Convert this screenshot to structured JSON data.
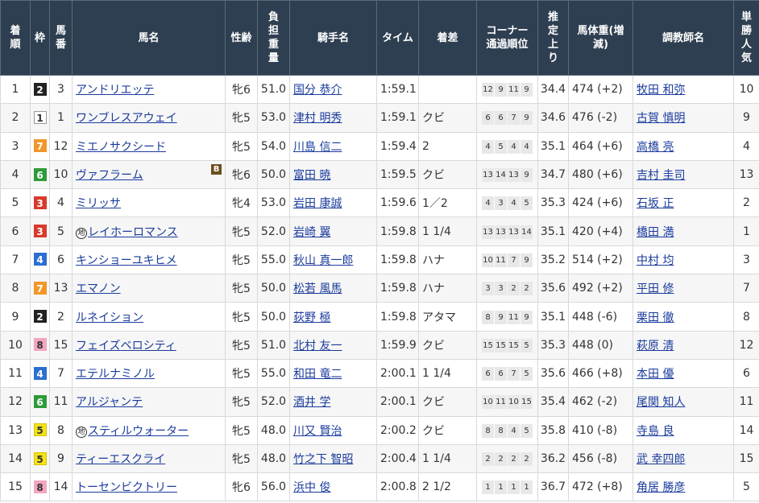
{
  "headers": {
    "rank": "着順",
    "frame": "枠",
    "num": "馬番",
    "horse": "馬名",
    "sexage": "性齢",
    "weight": "負担重量",
    "jockey": "騎手名",
    "time": "タイム",
    "margin": "着差",
    "corner": "コーナー通過順位",
    "last3f": "推定上り",
    "body": "馬体重(増減)",
    "trainer": "調教師名",
    "pop": "単勝人気"
  },
  "frame_colors": {
    "1": {
      "bg": "#ffffff",
      "fg": "#333333",
      "border": "#999999"
    },
    "2": {
      "bg": "#222222",
      "fg": "#ffffff",
      "border": "#222222"
    },
    "3": {
      "bg": "#d93a2b",
      "fg": "#ffffff",
      "border": "#d93a2b"
    },
    "4": {
      "bg": "#2a6fd1",
      "fg": "#ffffff",
      "border": "#2a6fd1"
    },
    "5": {
      "bg": "#f4e21a",
      "fg": "#333333",
      "border": "#d8c400"
    },
    "6": {
      "bg": "#2f9a3a",
      "fg": "#ffffff",
      "border": "#2f9a3a"
    },
    "7": {
      "bg": "#f2962a",
      "fg": "#ffffff",
      "border": "#f2962a"
    },
    "8": {
      "bg": "#f4a6c0",
      "fg": "#333333",
      "border": "#f4a6c0"
    }
  },
  "rows": [
    {
      "rank": "1",
      "frame": "2",
      "num": "3",
      "horse": "アンドリエッテ",
      "chihou": false,
      "blinker": false,
      "sexage": "牝6",
      "weight": "51.0",
      "jockey": "国分 恭介",
      "time": "1:59.1",
      "margin": "",
      "corner": [
        "12",
        "9",
        "11",
        "9"
      ],
      "last3f": "34.4",
      "body": "474 (+2)",
      "trainer": "牧田 和弥",
      "pop": "10"
    },
    {
      "rank": "2",
      "frame": "1",
      "num": "1",
      "horse": "ワンブレスアウェイ",
      "chihou": false,
      "blinker": false,
      "sexage": "牝5",
      "weight": "53.0",
      "jockey": "津村 明秀",
      "time": "1:59.1",
      "margin": "クビ",
      "corner": [
        "6",
        "6",
        "7",
        "9"
      ],
      "last3f": "34.6",
      "body": "476 (-2)",
      "trainer": "古賀 慎明",
      "pop": "9"
    },
    {
      "rank": "3",
      "frame": "7",
      "num": "12",
      "horse": "ミエノサクシード",
      "chihou": false,
      "blinker": false,
      "sexage": "牝5",
      "weight": "54.0",
      "jockey": "川島 信二",
      "time": "1:59.4",
      "margin": "2",
      "corner": [
        "4",
        "5",
        "4",
        "4"
      ],
      "last3f": "35.1",
      "body": "464 (+6)",
      "trainer": "高橋 亮",
      "pop": "4"
    },
    {
      "rank": "4",
      "frame": "6",
      "num": "10",
      "horse": "ヴァフラーム",
      "chihou": false,
      "blinker": true,
      "blinker_label": "B",
      "sexage": "牝6",
      "weight": "50.0",
      "jockey": "富田 暁",
      "time": "1:59.5",
      "margin": "クビ",
      "corner": [
        "13",
        "14",
        "13",
        "9"
      ],
      "last3f": "34.7",
      "body": "480 (+6)",
      "trainer": "吉村 圭司",
      "pop": "13"
    },
    {
      "rank": "5",
      "frame": "3",
      "num": "4",
      "horse": "ミリッサ",
      "chihou": false,
      "blinker": false,
      "sexage": "牝4",
      "weight": "53.0",
      "jockey": "岩田 康誠",
      "time": "1:59.6",
      "margin": "1／2",
      "corner": [
        "4",
        "3",
        "4",
        "5"
      ],
      "last3f": "35.3",
      "body": "424 (+6)",
      "trainer": "石坂 正",
      "pop": "2"
    },
    {
      "rank": "6",
      "frame": "3",
      "num": "5",
      "horse": "レイホーロマンス",
      "chihou": true,
      "chihou_label": "地",
      "blinker": false,
      "sexage": "牝5",
      "weight": "52.0",
      "jockey": "岩崎 翼",
      "time": "1:59.8",
      "margin": "1 1/4",
      "corner": [
        "13",
        "13",
        "13",
        "14"
      ],
      "last3f": "35.1",
      "body": "420 (+4)",
      "trainer": "橋田 満",
      "pop": "1"
    },
    {
      "rank": "7",
      "frame": "4",
      "num": "6",
      "horse": "キンショーユキヒメ",
      "chihou": false,
      "blinker": false,
      "sexage": "牝5",
      "weight": "55.0",
      "jockey": "秋山 真一郎",
      "time": "1:59.8",
      "margin": "ハナ",
      "corner": [
        "10",
        "11",
        "7",
        "9"
      ],
      "last3f": "35.2",
      "body": "514 (+2)",
      "trainer": "中村 均",
      "pop": "3"
    },
    {
      "rank": "8",
      "frame": "7",
      "num": "13",
      "horse": "エマノン",
      "chihou": false,
      "blinker": false,
      "sexage": "牝5",
      "weight": "50.0",
      "jockey": "松若 風馬",
      "time": "1:59.8",
      "margin": "ハナ",
      "corner": [
        "3",
        "3",
        "2",
        "2"
      ],
      "last3f": "35.6",
      "body": "492 (+2)",
      "trainer": "平田 修",
      "pop": "7"
    },
    {
      "rank": "9",
      "frame": "2",
      "num": "2",
      "horse": "ルネイション",
      "chihou": false,
      "blinker": false,
      "sexage": "牝5",
      "weight": "50.0",
      "jockey": "荻野 極",
      "time": "1:59.8",
      "margin": "アタマ",
      "corner": [
        "8",
        "9",
        "11",
        "9"
      ],
      "last3f": "35.1",
      "body": "448 (-6)",
      "trainer": "栗田 徹",
      "pop": "8"
    },
    {
      "rank": "10",
      "frame": "8",
      "num": "15",
      "horse": "フェイズベロシティ",
      "chihou": false,
      "blinker": false,
      "sexage": "牝5",
      "weight": "51.0",
      "jockey": "北村 友一",
      "time": "1:59.9",
      "margin": "クビ",
      "corner": [
        "15",
        "15",
        "15",
        "5"
      ],
      "last3f": "35.3",
      "body": "448 (0)",
      "trainer": "萩原 清",
      "pop": "12"
    },
    {
      "rank": "11",
      "frame": "4",
      "num": "7",
      "horse": "エテルナミノル",
      "chihou": false,
      "blinker": false,
      "sexage": "牝5",
      "weight": "55.0",
      "jockey": "和田 竜二",
      "time": "2:00.1",
      "margin": "1 1/4",
      "corner": [
        "6",
        "6",
        "7",
        "5"
      ],
      "last3f": "35.6",
      "body": "466 (+8)",
      "trainer": "本田 優",
      "pop": "6"
    },
    {
      "rank": "12",
      "frame": "6",
      "num": "11",
      "horse": "アルジャンテ",
      "chihou": false,
      "blinker": false,
      "sexage": "牝5",
      "weight": "52.0",
      "jockey": "酒井 学",
      "time": "2:00.1",
      "margin": "クビ",
      "corner": [
        "10",
        "11",
        "10",
        "15"
      ],
      "last3f": "35.4",
      "body": "462 (-2)",
      "trainer": "尾関 知人",
      "pop": "11"
    },
    {
      "rank": "13",
      "frame": "5",
      "num": "8",
      "horse": "スティルウォーター",
      "chihou": true,
      "chihou_label": "地",
      "blinker": false,
      "sexage": "牝5",
      "weight": "48.0",
      "jockey": "川又 賢治",
      "time": "2:00.2",
      "margin": "クビ",
      "corner": [
        "8",
        "8",
        "4",
        "5"
      ],
      "last3f": "35.8",
      "body": "410 (-8)",
      "trainer": "寺島 良",
      "pop": "14"
    },
    {
      "rank": "14",
      "frame": "5",
      "num": "9",
      "horse": "ティーエスクライ",
      "chihou": false,
      "blinker": false,
      "sexage": "牝5",
      "weight": "48.0",
      "jockey": "竹之下 智昭",
      "time": "2:00.4",
      "margin": "1 1/4",
      "corner": [
        "2",
        "2",
        "2",
        "2"
      ],
      "last3f": "36.2",
      "body": "456 (-8)",
      "trainer": "武 幸四郎",
      "pop": "15"
    },
    {
      "rank": "15",
      "frame": "8",
      "num": "14",
      "horse": "トーセンビクトリー",
      "chihou": false,
      "blinker": false,
      "sexage": "牝6",
      "weight": "56.0",
      "jockey": "浜中 俊",
      "time": "2:00.8",
      "margin": "2 1/2",
      "corner": [
        "1",
        "1",
        "1",
        "1"
      ],
      "last3f": "36.7",
      "body": "472 (+8)",
      "trainer": "角居 勝彦",
      "pop": "5"
    }
  ]
}
